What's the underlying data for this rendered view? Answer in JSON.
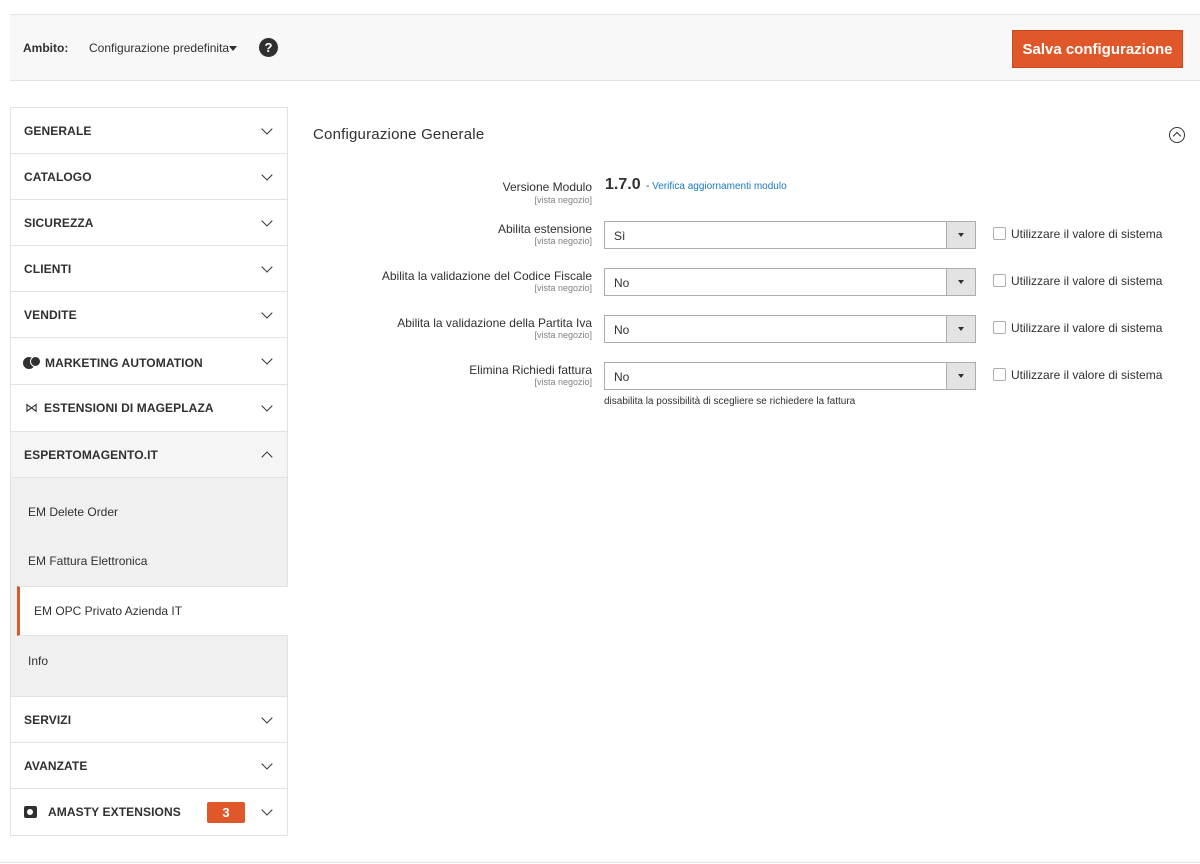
{
  "scope": {
    "label": "Ambito:",
    "value": "Configurazione predefinita",
    "help": "?"
  },
  "actions": {
    "save_label": "Salva configurazione"
  },
  "sidebar": {
    "tabs": [
      {
        "label": "GENERALE"
      },
      {
        "label": "CATALOGO"
      },
      {
        "label": "SICUREZZA"
      },
      {
        "label": "CLIENTI"
      },
      {
        "label": "VENDITE"
      },
      {
        "label": "MARKETING AUTOMATION"
      },
      {
        "label": "ESTENSIONI DI MAGEPLAZA"
      },
      {
        "label": "ESPERTOMAGENTO.IT"
      },
      {
        "label": "SERVIZI"
      },
      {
        "label": "AVANZATE"
      },
      {
        "label": "AMASTY EXTENSIONS",
        "badge": "3"
      }
    ],
    "esperto_items": [
      {
        "label": "EM Delete Order"
      },
      {
        "label": "EM Fattura Elettronica"
      },
      {
        "label": "EM OPC Privato Azienda IT"
      },
      {
        "label": "Info"
      }
    ],
    "mageplaza_glyph": "⋈"
  },
  "section": {
    "title": "Configurazione Generale",
    "scope_hint": "[vista negozio]",
    "version": {
      "label": "Versione Modulo",
      "value": "1.7.0",
      "link_prefix": "-",
      "link": "Verifica aggiornamenti modulo"
    },
    "fields": [
      {
        "label": "Abilita estensione",
        "value": "Sì",
        "use_system": "Utilizzare il valore di sistema"
      },
      {
        "label": "Abilita la validazione del Codice Fiscale",
        "value": "No",
        "use_system": "Utilizzare il valore di sistema"
      },
      {
        "label": "Abilita la validazione della Partita Iva",
        "value": "No",
        "use_system": "Utilizzare il valore di sistema"
      },
      {
        "label": "Elimina Richiedi fattura",
        "value": "No",
        "use_system": "Utilizzare il valore di sistema",
        "note": "disabilita la possibilità di scegliere se richiedere la fattura"
      }
    ]
  },
  "colors": {
    "accent": "#e0582a",
    "link": "#1979c3"
  }
}
